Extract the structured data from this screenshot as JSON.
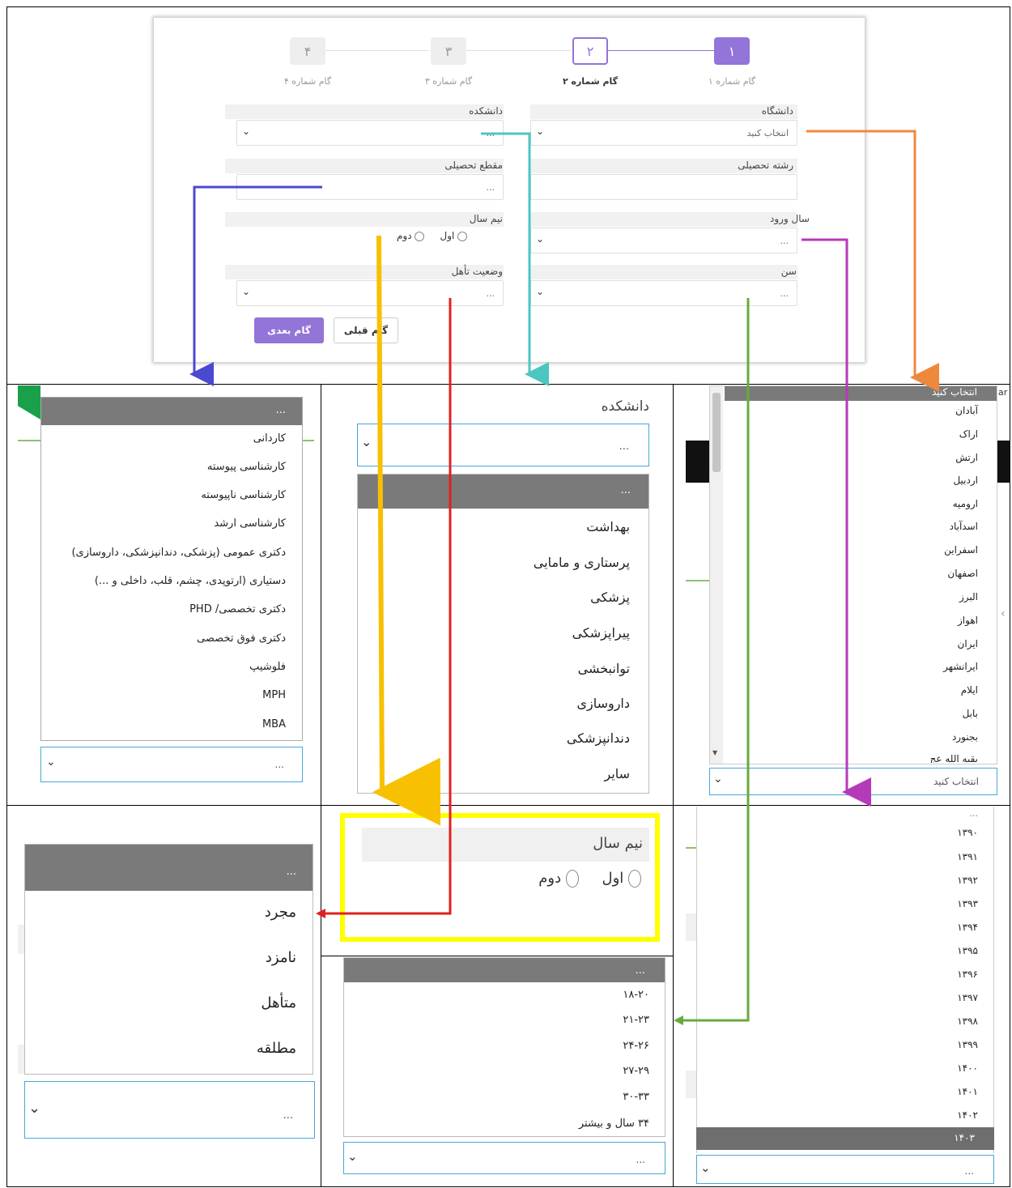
{
  "wizard": {
    "steps": [
      {
        "num": "۱",
        "label": "گام شماره ۱"
      },
      {
        "num": "۲",
        "label": "گام شماره ۲"
      },
      {
        "num": "۳",
        "label": "گام شماره ۳"
      },
      {
        "num": "۴",
        "label": "گام شماره ۴"
      }
    ],
    "fields": {
      "university": {
        "label": "دانشگاه",
        "value": "انتخاب کنید"
      },
      "faculty": {
        "label": "دانشکده",
        "value": "..."
      },
      "major": {
        "label": "رشته تحصیلی",
        "value": ""
      },
      "degree": {
        "label": "مقطع تحصیلی",
        "value": "..."
      },
      "entry_year": {
        "label": "سال ورود",
        "value": "..."
      },
      "semester": {
        "label": "نیم سال",
        "options": [
          "اول",
          "دوم"
        ]
      },
      "age": {
        "label": "سن",
        "value": "..."
      },
      "marital": {
        "label": "وضعیت تأهل",
        "value": "..."
      }
    },
    "buttons": {
      "next": "گام بعدی",
      "prev": "گام قبلی"
    }
  },
  "degree_dropdown": {
    "header": "...",
    "items": [
      "کاردانی",
      "کارشناسی پیوسته",
      "کارشناسی ناپیوسته",
      "کارشناسی ارشد",
      "دکتری عمومی (پزشکی، دندانپزشکی، داروسازی)",
      "دستیاری (ارتوپدی، چشم، قلب، داخلی و ...)",
      "دکتری تخصصی/ PHD",
      "دکتری فوق تخصصی",
      "فلوشیپ",
      "MPH",
      "MBA"
    ],
    "select_value": "..."
  },
  "faculty_dropdown": {
    "label": "دانشکده",
    "select_value": "...",
    "header": "...",
    "items": [
      "بهداشت",
      "پرستاری و مامایی",
      "پزشکی",
      "پیراپزشکی",
      "توانبخشی",
      "داروسازی",
      "دندانپزشکی",
      "سایر"
    ]
  },
  "university_dropdown": {
    "header": "انتخاب کنید",
    "items": [
      "آبادان",
      "اراک",
      "ارتش",
      "اردبیل",
      "ارومیه",
      "اسدآباد",
      "اسفراین",
      "اصفهان",
      "البرز",
      "اهواز",
      "ایران",
      "ایرانشهر",
      "ایلام",
      "بابل",
      "بجنورد",
      "بقیه الله عج"
    ],
    "select_value": "انتخاب کنید",
    "fragment_left": "har"
  },
  "marital_dropdown": {
    "header": "...",
    "items": [
      "مجرد",
      "نامزد",
      "متأهل",
      "مطلقه"
    ],
    "select_value": "..."
  },
  "semester_zoom": {
    "label": "نیم سال",
    "options": [
      "اول",
      "دوم"
    ]
  },
  "age_dropdown": {
    "header": "...",
    "items": [
      "۱۸-۲۰",
      "۲۱-۲۳",
      "۲۴-۲۶",
      "۲۷-۲۹",
      "۳۰-۳۳",
      "۳۴ سال و بیشتر"
    ],
    "select_value": "..."
  },
  "year_dropdown": {
    "top": "...",
    "items": [
      "۱۳۹۰",
      "۱۳۹۱",
      "۱۳۹۲",
      "۱۳۹۳",
      "۱۳۹۴",
      "۱۳۹۵",
      "۱۳۹۶",
      "۱۳۹۷",
      "۱۳۹۸",
      "۱۳۹۹",
      "۱۴۰۰",
      "۱۴۰۱",
      "۱۴۰۲"
    ],
    "selected": "۱۴۰۳",
    "select_value": "..."
  },
  "colors": {
    "accent": "#9374d8",
    "arrow_blue": "#4a4ad0",
    "arrow_teal": "#4cc6c0",
    "arrow_orange": "#f0883c",
    "arrow_purple": "#b53ab8",
    "arrow_yellow": "#f7c000",
    "arrow_red": "#e02020",
    "arrow_green": "#6aaa3c",
    "highlight_yellow": "#ffff00"
  }
}
